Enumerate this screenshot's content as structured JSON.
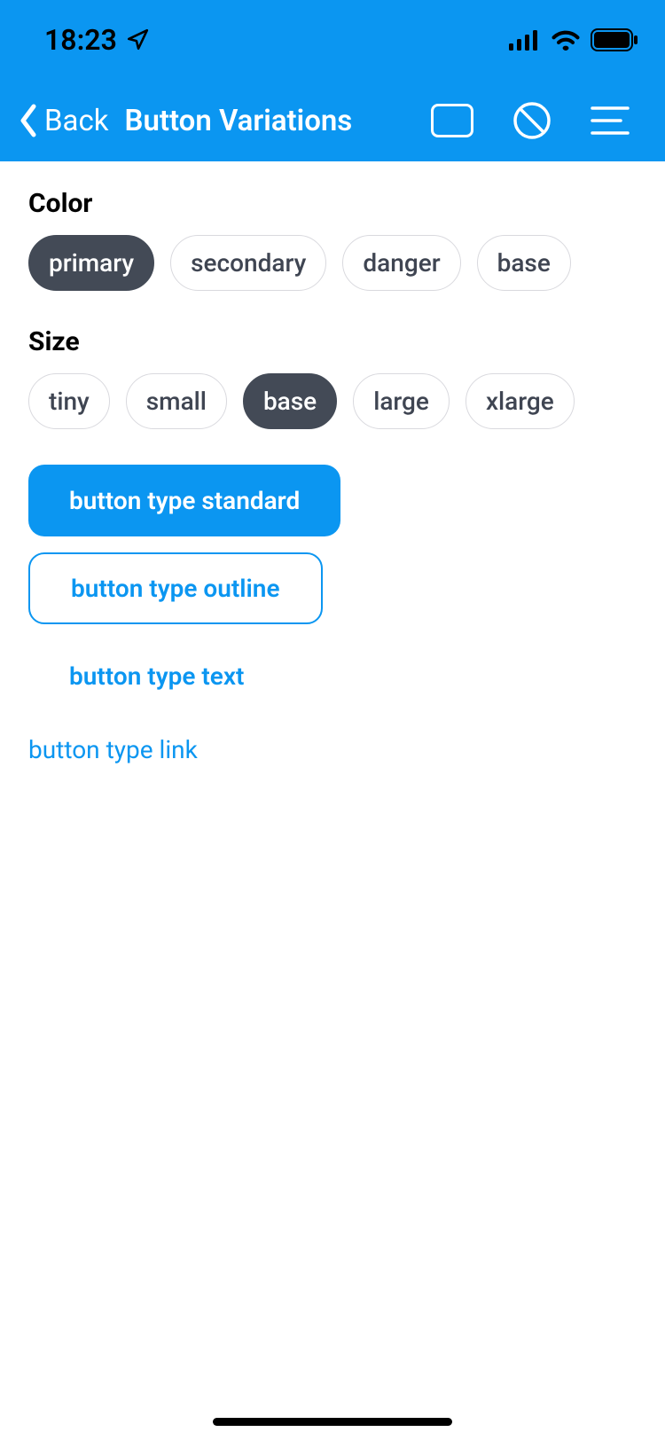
{
  "statusBar": {
    "time": "18:23"
  },
  "nav": {
    "backLabel": "Back",
    "title": "Button Variations"
  },
  "sections": {
    "colorLabel": "Color",
    "sizeLabel": "Size"
  },
  "colorOptions": {
    "primary": "primary",
    "secondary": "secondary",
    "danger": "danger",
    "base": "base"
  },
  "sizeOptions": {
    "tiny": "tiny",
    "small": "small",
    "base": "base",
    "large": "large",
    "xlarge": "xlarge"
  },
  "buttons": {
    "standard": "button type standard",
    "outline": "button type outline",
    "text": "button type text",
    "link": "button type link"
  },
  "colors": {
    "primary": "#0b96f1",
    "pillSelected": "#434a56"
  }
}
